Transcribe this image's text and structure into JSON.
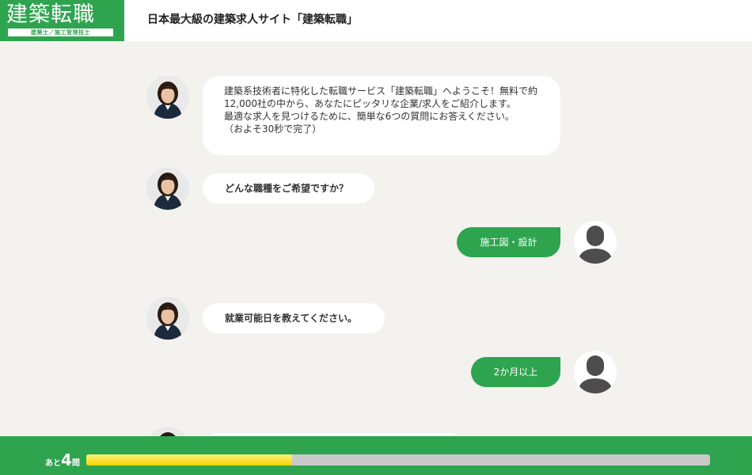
{
  "header": {
    "logo_main": "建築転職",
    "logo_sub": "建築士／施工管理技士",
    "site_title": "日本最大級の建築求人サイト「建築転職」"
  },
  "chat": {
    "intro_lines": [
      "建築系技術者に特化した転職サービス「建築転職」へようこそ！無料で約12,000社の中から、あなたにピッタリな企業/求人をご紹介します。",
      "最適な求人を見つけるために、簡単な6つの質問にお答えください。",
      "（およそ30秒で完了）"
    ],
    "question_1": "どんな職種をご希望ですか？",
    "answer_1": "施工図・設計",
    "question_2": "就業可能日を教えてください。",
    "answer_2": "2か月以上"
  },
  "footer": {
    "remaining_prefix": "あと",
    "remaining_count": "4",
    "remaining_suffix": "問",
    "progress": 0.33,
    "progress_color": "#f5d400"
  },
  "colors": {
    "brand_green": "#2ea44f",
    "background": "#f3f2ef"
  },
  "icons": {
    "assistant_avatar": "assistant-photo",
    "user_avatar": "person-silhouette-icon"
  }
}
